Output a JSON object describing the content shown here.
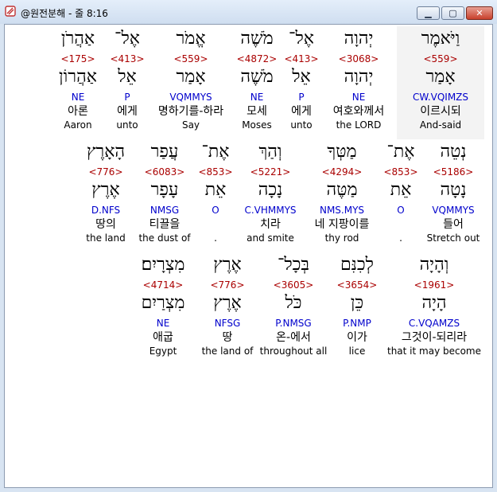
{
  "window": {
    "title": "@원전분해 - 줄 8:16",
    "buttons": {
      "minimize": "minimize-icon",
      "maximize": "maximize-icon",
      "close": "close-icon"
    }
  },
  "colors": {
    "number": "#aa0000",
    "parse": "#0000cc",
    "text": "#000000",
    "highlight": "#f3f3f3"
  },
  "rows": [
    {
      "words": [
        {
          "heb1": "וַיֹּאמֶר",
          "num": "<559>",
          "heb2": "אָמַר",
          "parse": "CW.VQIMZS",
          "kor": "이르시되",
          "eng": "And-said"
        },
        {
          "heb1": "יְהוָה",
          "num": "<3068>",
          "heb2": "יְהוָה",
          "parse": "NE",
          "kor": "여호와께서",
          "eng": "the LORD"
        },
        {
          "heb1": "אֶל־",
          "num": "<413>",
          "heb2": "אֵל",
          "parse": "P",
          "kor": "에게",
          "eng": "unto"
        },
        {
          "heb1": "מֹשֶׁה",
          "num": "<4872>",
          "heb2": "מֹשֶׁה",
          "parse": "NE",
          "kor": "모세",
          "eng": "Moses"
        },
        {
          "heb1": "אֱמֹר",
          "num": "<559>",
          "heb2": "אָמַר",
          "parse": "VQMMYS",
          "kor": "명하기를-하라",
          "eng": "Say"
        },
        {
          "heb1": "אֶל־",
          "num": "<413>",
          "heb2": "אֵל",
          "parse": "P",
          "kor": "에게",
          "eng": "unto"
        },
        {
          "heb1": "אַהֲרֹן",
          "num": "<175>",
          "heb2": "אַהֲרוֹן",
          "parse": "NE",
          "kor": "아론",
          "eng": "Aaron"
        }
      ]
    },
    {
      "words": [
        {
          "heb1": "נְטֵה",
          "num": "<5186>",
          "heb2": "נָטָה",
          "parse": "VQMMYS",
          "kor": "들어",
          "eng": "Stretch out"
        },
        {
          "heb1": "אֶת־",
          "num": "<853>",
          "heb2": "אֵת",
          "parse": "O",
          "kor": "",
          "eng": "."
        },
        {
          "heb1": "מַטְּךָ",
          "num": "<4294>",
          "heb2": "מַטֶּה",
          "parse": "NMS.MYS",
          "kor": "네 지팡이를",
          "eng": "thy rod"
        },
        {
          "heb1": "וְהַךְ",
          "num": "<5221>",
          "heb2": "נָכָה",
          "parse": "C.VHMMYS",
          "kor": "치라",
          "eng": "and smite"
        },
        {
          "heb1": "אֶת־",
          "num": "<853>",
          "heb2": "אֵת",
          "parse": "O",
          "kor": "",
          "eng": "."
        },
        {
          "heb1": "עֲפַר",
          "num": "<6083>",
          "heb2": "עָפָר",
          "parse": "NMSG",
          "kor": "티끌을",
          "eng": "the dust of"
        },
        {
          "heb1": "הָאָרֶץ",
          "num": "<776>",
          "heb2": "אֶרֶץ",
          "parse": "D.NFS",
          "kor": "땅의",
          "eng": "the land"
        }
      ]
    },
    {
      "words": [
        {
          "heb1": "וְהָיָה",
          "num": "<1961>",
          "heb2": "הָיָה",
          "parse": "C.VQAMZS",
          "kor": "그것이-되리라",
          "eng": "that it may become"
        },
        {
          "heb1": "לְכִנִּם",
          "num": "<3654>",
          "heb2": "כֵּן",
          "parse": "P.NMP",
          "kor": "이가",
          "eng": "lice"
        },
        {
          "heb1": "בְּכָל־",
          "num": "<3605>",
          "heb2": "כֹּל",
          "parse": "P.NMSG",
          "kor": "온-에서",
          "eng": "throughout all"
        },
        {
          "heb1": "אֶרֶץ",
          "num": "<776>",
          "heb2": "אֶרֶץ",
          "parse": "NFSG",
          "kor": "땅",
          "eng": "the land of"
        },
        {
          "heb1": "מִצְרָיִם׃",
          "num": "<4714>",
          "heb2": "מִצְרַיִם",
          "parse": "NE",
          "kor": "애굽",
          "eng": "Egypt"
        }
      ]
    }
  ]
}
